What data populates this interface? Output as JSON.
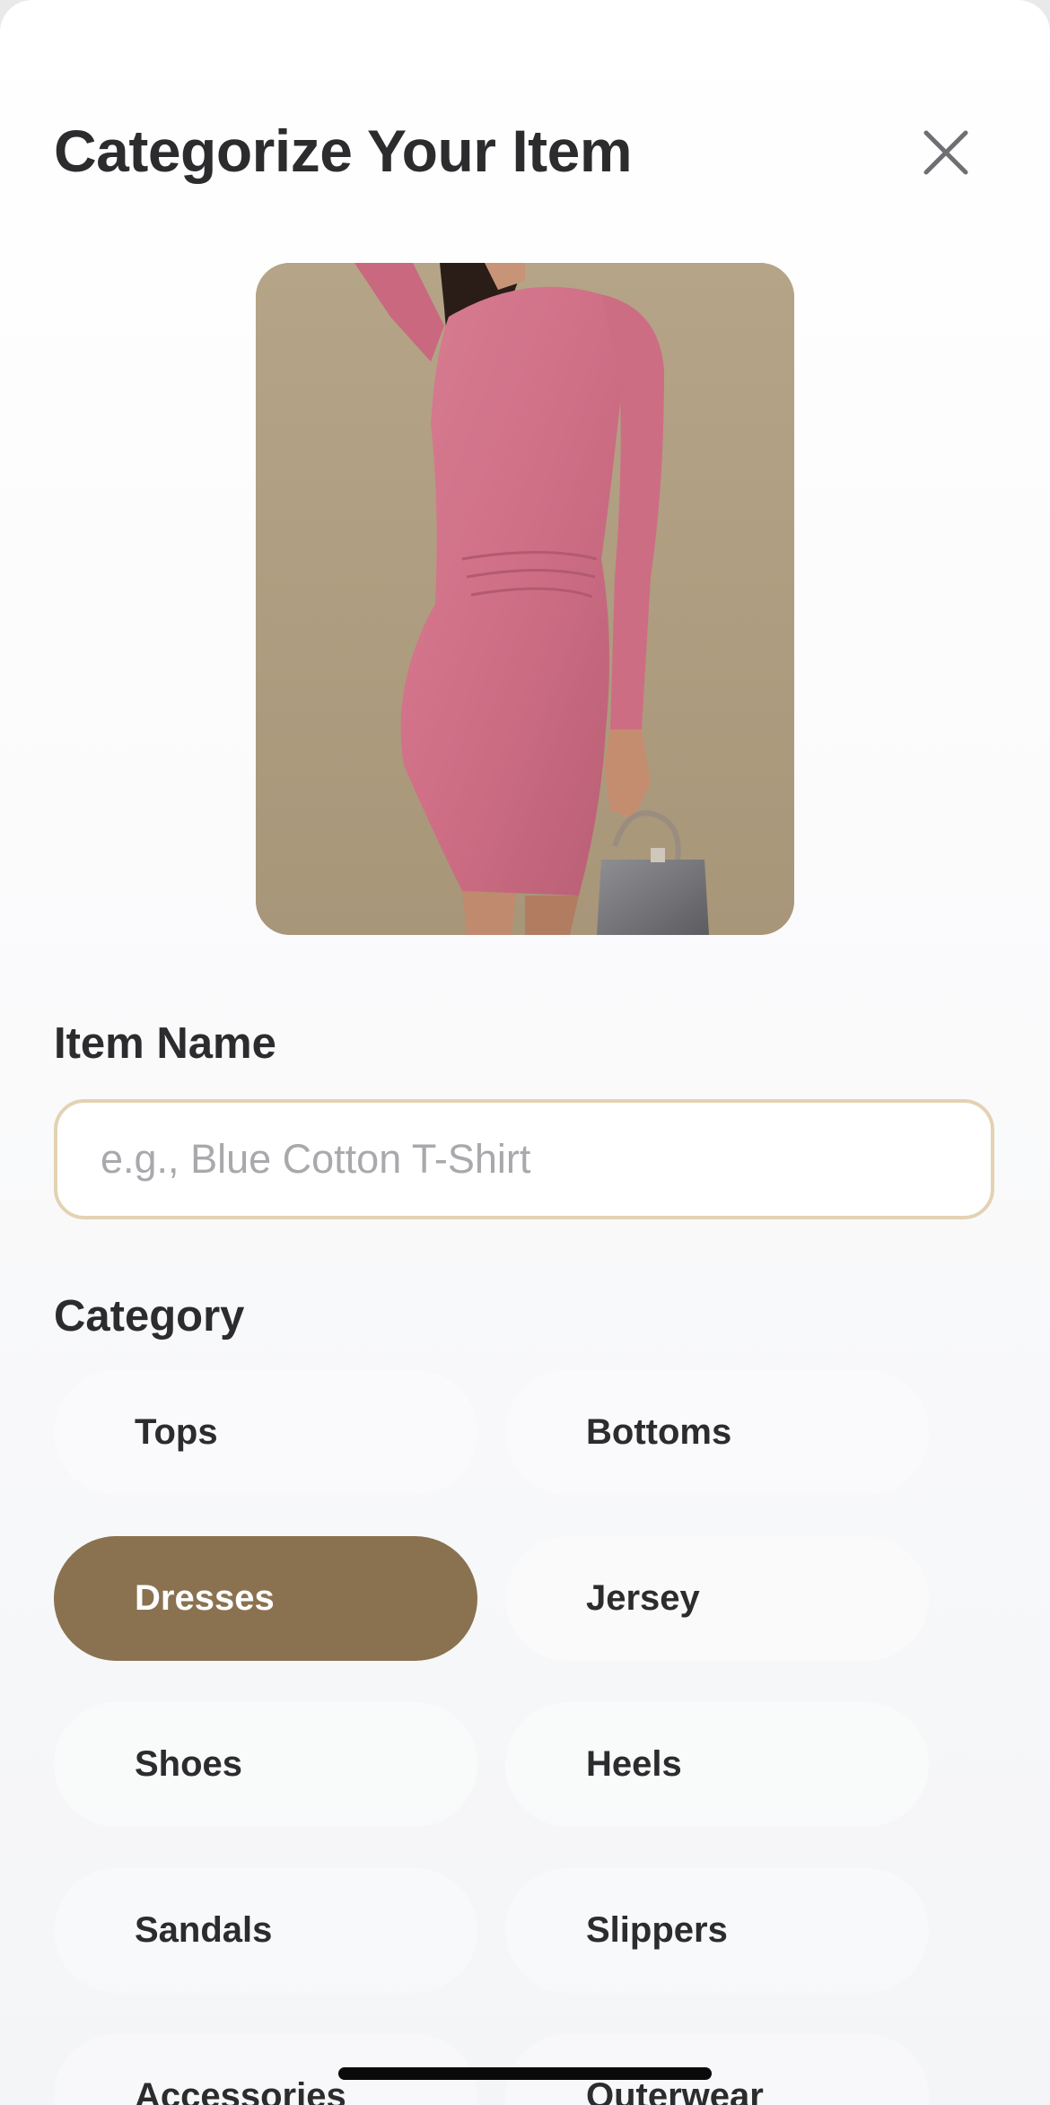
{
  "header": {
    "title": "Categorize Your Item",
    "close_icon": "close-icon"
  },
  "photo": {
    "description_icon": "item-photo"
  },
  "item_name": {
    "label": "Item Name",
    "value": "",
    "placeholder": "e.g., Blue Cotton T-Shirt"
  },
  "category": {
    "label": "Category",
    "selected": "Dresses",
    "options": [
      "Tops",
      "Bottoms",
      "Dresses",
      "Jersey",
      "Shoes",
      "Heels",
      "Sandals",
      "Slippers",
      "Accessories",
      "Outerwear"
    ]
  },
  "colors": {
    "accent": "#8a7250",
    "input_border": "#e3d2b3",
    "text": "#2c2c2e"
  }
}
